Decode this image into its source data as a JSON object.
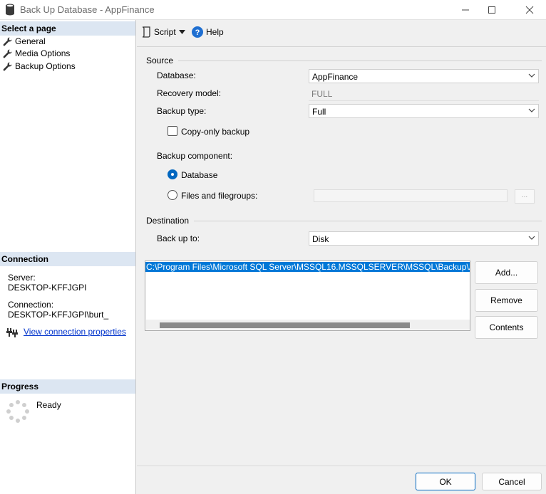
{
  "window": {
    "title": "Back Up Database - AppFinance",
    "icon": "database-icon",
    "controls": [
      "minimize-icon",
      "maximize-icon",
      "close-icon"
    ]
  },
  "left": {
    "select_page_header": "Select a page",
    "pages": [
      {
        "label": "General",
        "icon": "wrench-icon"
      },
      {
        "label": "Media Options",
        "icon": "wrench-icon"
      },
      {
        "label": "Backup Options",
        "icon": "wrench-icon"
      }
    ],
    "connection_header": "Connection",
    "server_label": "Server:",
    "server_value": "DESKTOP-KFFJGPI",
    "connection_label": "Connection:",
    "connection_value": "DESKTOP-KFFJGPI\\burt_",
    "view_props_link": "View connection properties",
    "progress_header": "Progress",
    "progress_status": "Ready"
  },
  "toolbar": {
    "script_label": "Script",
    "help_label": "Help"
  },
  "source": {
    "group_label": "Source",
    "database_label": "Database:",
    "database_value": "AppFinance",
    "recovery_label": "Recovery model:",
    "recovery_value": "FULL",
    "backup_type_label": "Backup type:",
    "backup_type_value": "Full",
    "copy_only_label": "Copy-only backup",
    "copy_only_checked": false,
    "component_label": "Backup component:",
    "component_database_label": "Database",
    "component_files_label": "Files and filegroups:",
    "selected_component": "Database",
    "files_browse_label": "..."
  },
  "destination": {
    "group_label": "Destination",
    "backup_to_label": "Back up to:",
    "backup_to_value": "Disk",
    "paths": [
      "C:\\Program Files\\Microsoft SQL Server\\MSSQL16.MSSQLSERVER\\MSSQL\\Backup\\AppFinance.bak"
    ],
    "add_label": "Add...",
    "remove_label": "Remove",
    "contents_label": "Contents"
  },
  "footer": {
    "ok_label": "OK",
    "cancel_label": "Cancel"
  },
  "colors": {
    "accent": "#0067c0",
    "selection": "#0078d7",
    "section_header_bg": "#dce6f2",
    "link": "#0033cc"
  }
}
